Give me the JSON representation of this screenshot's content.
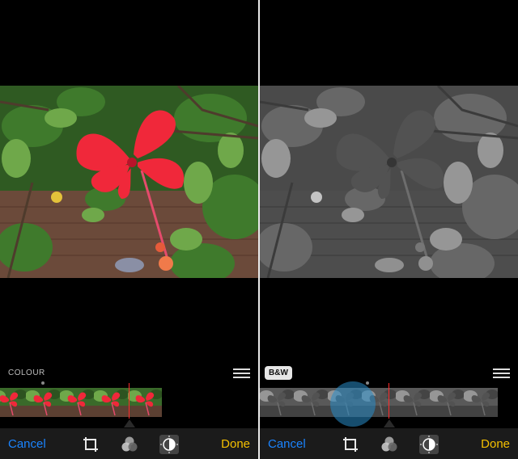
{
  "left_panel": {
    "filter_label": "COLOUR",
    "cancel_label": "Cancel",
    "done_label": "Done"
  },
  "right_panel": {
    "filter_label": "B&W",
    "cancel_label": "Cancel",
    "done_label": "Done"
  },
  "icons": [
    "crop-icon",
    "filters-icon",
    "adjust-icon",
    "filter-list-icon"
  ],
  "colors": {
    "cancel": "#1a84ff",
    "done": "#f5c000",
    "indicator": "#ff2b2b",
    "toolbar": "#1b1b1b"
  }
}
